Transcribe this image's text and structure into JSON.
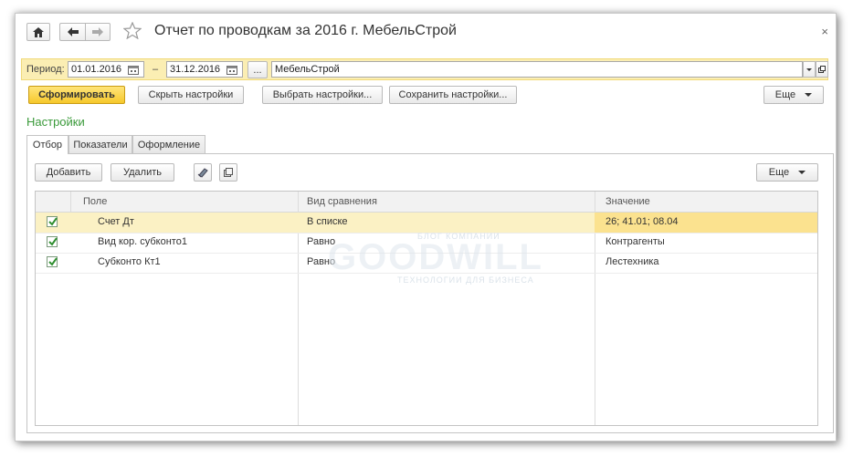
{
  "window": {
    "title": "Отчет по проводкам за 2016 г. МебельСтрой",
    "close_glyph": "×"
  },
  "period": {
    "label": "Период:",
    "date_from": "01.01.2016",
    "dash": "–",
    "date_to": "31.12.2016",
    "ellipsis": "...",
    "organization": "МебельСтрой"
  },
  "toolbar": {
    "generate": "Сформировать",
    "hide_settings": "Скрыть настройки",
    "choose_settings": "Выбрать настройки...",
    "save_settings": "Сохранить настройки...",
    "more": "Еще"
  },
  "settings": {
    "title": "Настройки",
    "tabs": [
      "Отбор",
      "Показатели",
      "Оформление"
    ],
    "add": "Добавить",
    "delete": "Удалить",
    "more": "Еще"
  },
  "grid": {
    "columns": [
      "Поле",
      "Вид сравнения",
      "Значение"
    ],
    "rows": [
      {
        "field": "Счет Дт",
        "comparison": "В списке",
        "value": "26; 41.01; 08.04",
        "checked": true
      },
      {
        "field": "Вид кор. субконто1",
        "comparison": "Равно",
        "value": "Контрагенты",
        "checked": true
      },
      {
        "field": "Субконто Кт1",
        "comparison": "Равно",
        "value": "Лестехника",
        "checked": true
      }
    ]
  },
  "watermark": {
    "top": "БЛОГ КОМПАНИИ",
    "main": "GOODWILL",
    "bottom": "ТЕХНОЛОГИИ ДЛЯ БИЗНЕСА"
  },
  "colors": {
    "accent_yellow": "#f6c82c",
    "section_green": "#3a9a3a",
    "selected_row": "#fbe28f"
  }
}
